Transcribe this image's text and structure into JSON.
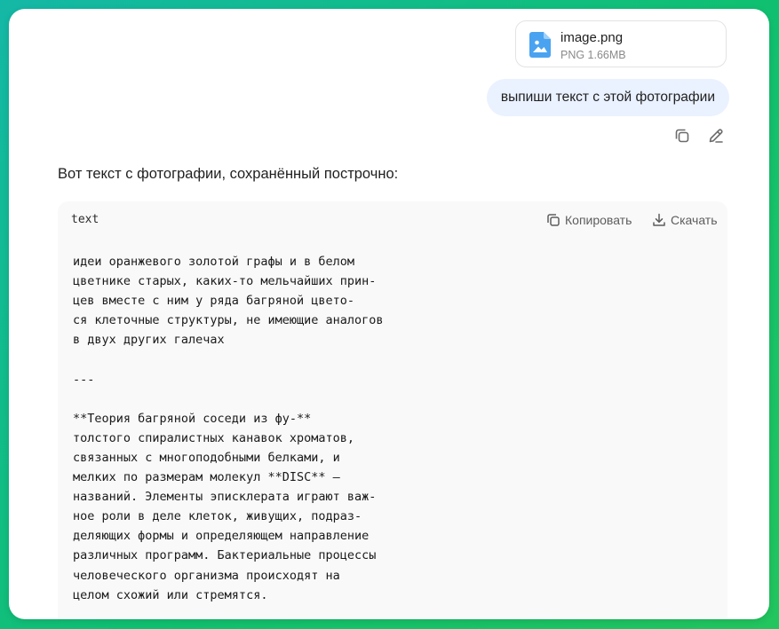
{
  "attachment": {
    "file_name": "image.png",
    "file_meta": "PNG 1.66MB",
    "icon": "image-file-icon"
  },
  "user_message": "выпиши текст с этой фотографии",
  "message_actions": {
    "copy_icon": "copy-icon",
    "edit_icon": "pencil-icon"
  },
  "assistant": {
    "intro": "Вот текст с фотографии, сохранённый построчно:",
    "code_block": {
      "language": "text",
      "copy_label": "Копировать",
      "download_label": "Скачать",
      "content": "идеи оранжевого золотой графы и в белом\nцветнике старых, каких-то мельчайших прин-\nцев вместе с ним у ряда багряной цвето-\nся клеточные структуры, не имеющие аналогов\nв двух других галечах\n\n---\n\n**Теория багряной соседи из фу-**\nтолстого спиралистных канавок хроматов,\nсвязанных с многоподобными белками, и\nмелких по размерам молекул **DISC** —\nназваний. Элементы эписклерата играют важ-\nное роли в деле клеток, живущих, подраз-\nделяющих формы и определяющем направление\nразличных программ. Бактериальные процессы\nчеловеческого организма происходят на\nцелом схожий или стремятся."
    }
  },
  "colors": {
    "frame_gradient_start": "#14b8a6",
    "frame_gradient_end": "#22c55e",
    "user_bubble": "#eaf1ff",
    "code_background": "#f9f9f9",
    "file_icon_blue": "#4aa3f0"
  }
}
